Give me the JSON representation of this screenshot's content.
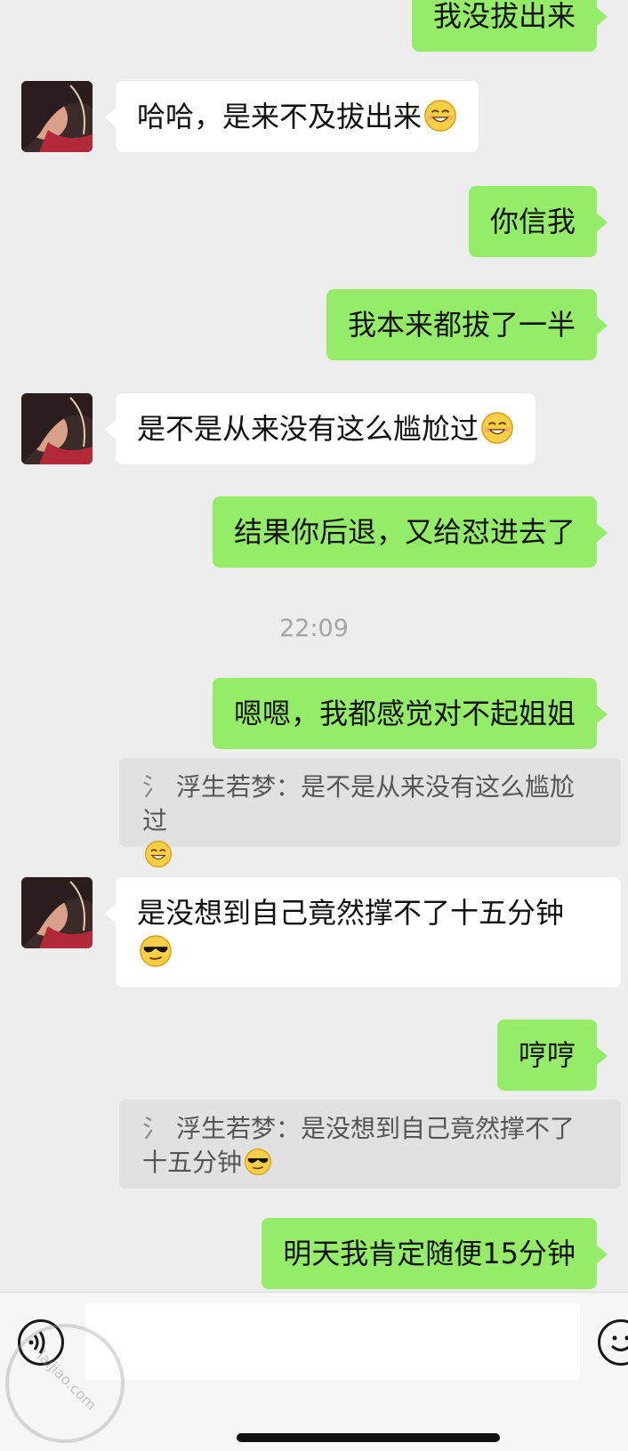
{
  "messages": {
    "m0": "我没拔出来",
    "m1": "哈哈，是来不及拔出来",
    "m2": "你信我",
    "m3": "我本来都拔了一半",
    "m4": "是不是从来没有这么尴尬过",
    "m5": "结果你后退，又给怼进去了",
    "time": "22:09",
    "m6": "嗯嗯，我都感觉对不起姐姐",
    "quote1": "浮生若梦：是不是从来没有这么尴尬过",
    "m7": "是没想到自己竟然撑不了十五分钟",
    "m8": "哼哼",
    "quote2": "浮生若梦：是没想到自己竟然撑不了十五分钟",
    "m9": "明天我肯定随便15分钟"
  },
  "quote_mark": "氵",
  "input": {
    "placeholder": ""
  },
  "watermark": "laijiao.com",
  "colors": {
    "outgoing": "#95ec69",
    "incoming": "#ffffff",
    "background": "#ededed"
  }
}
